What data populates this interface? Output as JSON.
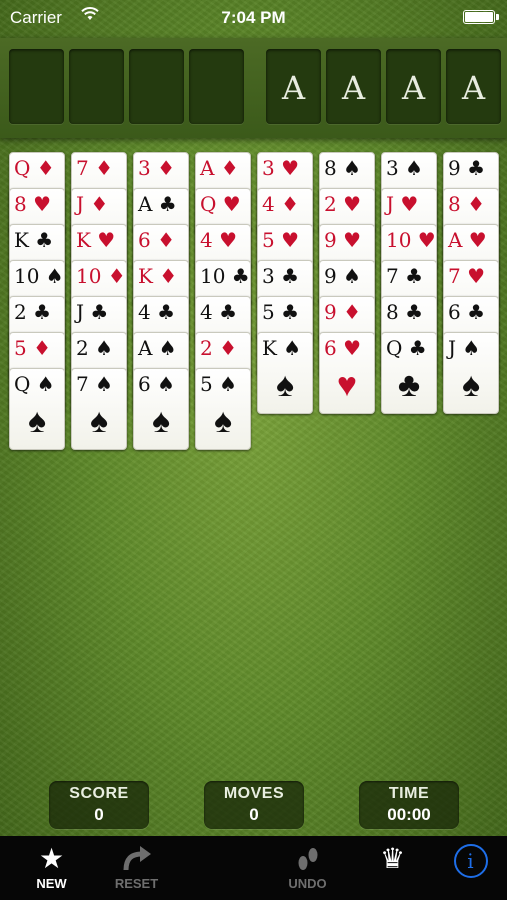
{
  "status_bar": {
    "carrier": "Carrier",
    "time": "7:04 PM"
  },
  "free_cells": [
    {
      "label": ""
    },
    {
      "label": ""
    },
    {
      "label": ""
    },
    {
      "label": ""
    }
  ],
  "foundations": [
    {
      "label": "A"
    },
    {
      "label": "A"
    },
    {
      "label": "A"
    },
    {
      "label": "A"
    }
  ],
  "colors": {
    "red_suit": "#c8102e",
    "black_suit": "#111111",
    "table_green": "#5f8a2a",
    "info_blue": "#1e6ee8"
  },
  "tableau": [
    [
      {
        "rank": "Q",
        "suit": "♦",
        "color": "red"
      },
      {
        "rank": "8",
        "suit": "♥",
        "color": "red"
      },
      {
        "rank": "K",
        "suit": "♣",
        "color": "black"
      },
      {
        "rank": "10",
        "suit": "♠",
        "color": "black"
      },
      {
        "rank": "2",
        "suit": "♣",
        "color": "black"
      },
      {
        "rank": "5",
        "suit": "♦",
        "color": "red"
      },
      {
        "rank": "Q",
        "suit": "♠",
        "color": "black"
      }
    ],
    [
      {
        "rank": "7",
        "suit": "♦",
        "color": "red"
      },
      {
        "rank": "J",
        "suit": "♦",
        "color": "red"
      },
      {
        "rank": "K",
        "suit": "♥",
        "color": "red"
      },
      {
        "rank": "10",
        "suit": "♦",
        "color": "red"
      },
      {
        "rank": "J",
        "suit": "♣",
        "color": "black"
      },
      {
        "rank": "2",
        "suit": "♠",
        "color": "black"
      },
      {
        "rank": "7",
        "suit": "♠",
        "color": "black"
      }
    ],
    [
      {
        "rank": "3",
        "suit": "♦",
        "color": "red"
      },
      {
        "rank": "A",
        "suit": "♣",
        "color": "black"
      },
      {
        "rank": "6",
        "suit": "♦",
        "color": "red"
      },
      {
        "rank": "K",
        "suit": "♦",
        "color": "red"
      },
      {
        "rank": "4",
        "suit": "♣",
        "color": "black"
      },
      {
        "rank": "A",
        "suit": "♠",
        "color": "black"
      },
      {
        "rank": "6",
        "suit": "♠",
        "color": "black"
      }
    ],
    [
      {
        "rank": "A",
        "suit": "♦",
        "color": "red"
      },
      {
        "rank": "Q",
        "suit": "♥",
        "color": "red"
      },
      {
        "rank": "4",
        "suit": "♥",
        "color": "red"
      },
      {
        "rank": "10",
        "suit": "♣",
        "color": "black"
      },
      {
        "rank": "4",
        "suit": "♣",
        "color": "black"
      },
      {
        "rank": "2",
        "suit": "♦",
        "color": "red"
      },
      {
        "rank": "5",
        "suit": "♠",
        "color": "black"
      }
    ],
    [
      {
        "rank": "3",
        "suit": "♥",
        "color": "red"
      },
      {
        "rank": "4",
        "suit": "♦",
        "color": "red"
      },
      {
        "rank": "5",
        "suit": "♥",
        "color": "red"
      },
      {
        "rank": "3",
        "suit": "♣",
        "color": "black"
      },
      {
        "rank": "5",
        "suit": "♣",
        "color": "black"
      },
      {
        "rank": "K",
        "suit": "♠",
        "color": "black"
      }
    ],
    [
      {
        "rank": "8",
        "suit": "♠",
        "color": "black"
      },
      {
        "rank": "2",
        "suit": "♥",
        "color": "red"
      },
      {
        "rank": "9",
        "suit": "♥",
        "color": "red"
      },
      {
        "rank": "9",
        "suit": "♠",
        "color": "black"
      },
      {
        "rank": "9",
        "suit": "♦",
        "color": "red"
      },
      {
        "rank": "6",
        "suit": "♥",
        "color": "red"
      }
    ],
    [
      {
        "rank": "3",
        "suit": "♠",
        "color": "black"
      },
      {
        "rank": "J",
        "suit": "♥",
        "color": "red"
      },
      {
        "rank": "10",
        "suit": "♥",
        "color": "red"
      },
      {
        "rank": "7",
        "suit": "♣",
        "color": "black"
      },
      {
        "rank": "8",
        "suit": "♣",
        "color": "black"
      },
      {
        "rank": "Q",
        "suit": "♣",
        "color": "black"
      }
    ],
    [
      {
        "rank": "9",
        "suit": "♣",
        "color": "black"
      },
      {
        "rank": "8",
        "suit": "♦",
        "color": "red"
      },
      {
        "rank": "A",
        "suit": "♥",
        "color": "red"
      },
      {
        "rank": "7",
        "suit": "♥",
        "color": "red"
      },
      {
        "rank": "6",
        "suit": "♣",
        "color": "black"
      },
      {
        "rank": "J",
        "suit": "♠",
        "color": "black"
      }
    ]
  ],
  "stats": {
    "score_label": "SCORE",
    "score_value": "0",
    "moves_label": "MOVES",
    "moves_value": "0",
    "time_label": "TIME",
    "time_value": "00:00"
  },
  "toolbar": {
    "new_label": "NEW",
    "reset_label": "RESET",
    "undo_label": "UNDO"
  },
  "icons": {
    "new": "star-icon",
    "reset": "redo-arrow-icon",
    "undo": "footprints-icon",
    "crown": "crown-icon",
    "info": "info-icon"
  }
}
